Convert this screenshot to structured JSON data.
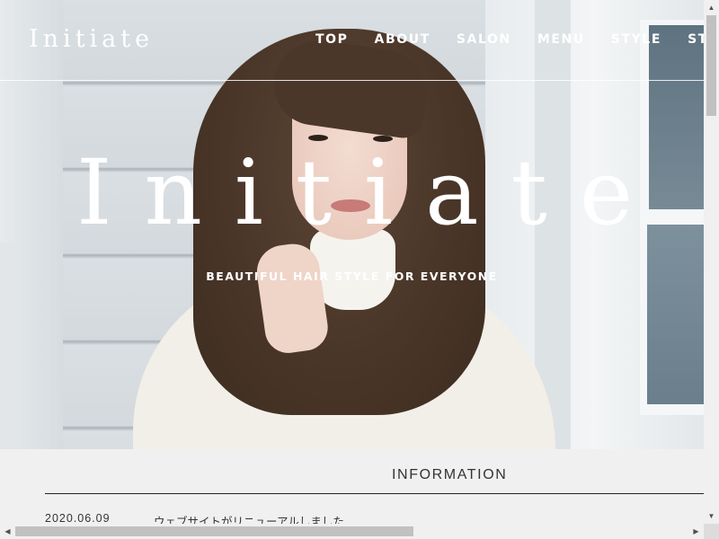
{
  "header": {
    "logo": "Initiate",
    "nav": [
      "TOP",
      "ABOUT",
      "SALON",
      "MENU",
      "STYLE",
      "ST"
    ]
  },
  "hero": {
    "title": "Initiate",
    "subtitle": "BEAUTIFUL HAIR STYLE FOR EVERYONE",
    "image_icon": "hero-portrait-photo"
  },
  "information": {
    "heading": "INFORMATION",
    "items": [
      {
        "date": "2020.06.09",
        "title": "ウェブサイトがリニューアルしました"
      }
    ]
  },
  "scrollbars": {
    "up_icon": "▲",
    "down_icon": "▼",
    "left_icon": "◀",
    "right_icon": "▶"
  }
}
